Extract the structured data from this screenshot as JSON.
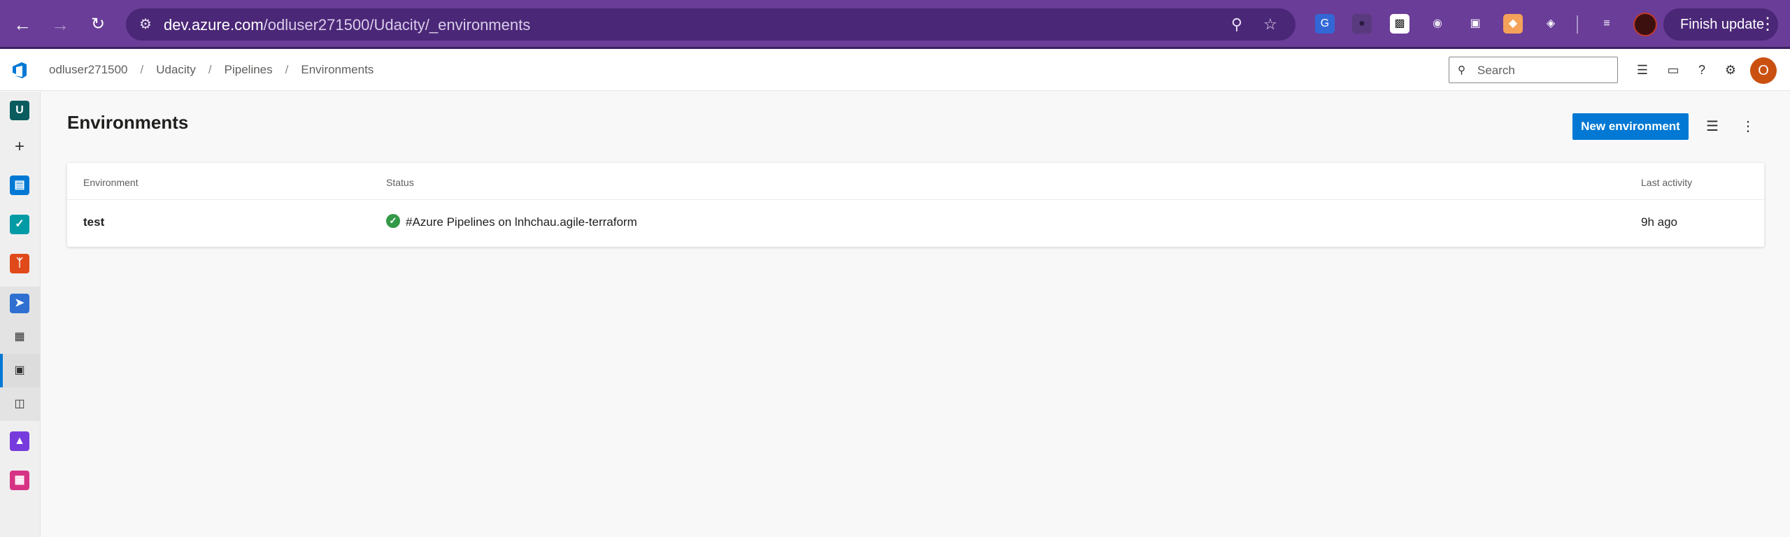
{
  "browser": {
    "url_host": "dev.azure.com",
    "url_path": "/odluser271500/Udacity/_environments",
    "finish_update_label": "Finish update",
    "icons": [
      "back-icon",
      "forward-icon",
      "reload-icon",
      "site-info-icon",
      "zoom-icon",
      "bookmark-star-icon",
      "translate-icon",
      "extension-icon",
      "qr-code-icon",
      "chrome-extension-icon",
      "picture-in-picture-icon",
      "extension-orange-icon",
      "puzzle-extensions-icon",
      "media-queue-icon",
      "profile-avatar",
      "more-vert-icon"
    ]
  },
  "header": {
    "breadcrumb": [
      "odluser271500",
      "Udacity",
      "Pipelines",
      "Environments"
    ],
    "separator": "/",
    "search_placeholder": "Search",
    "user_initial": "O",
    "icons": [
      "task-list-icon",
      "shopping-bag-icon",
      "help-icon",
      "user-settings-icon"
    ]
  },
  "left_nav": {
    "project_initial": "U",
    "items": [
      "project",
      "add",
      "overview",
      "boards",
      "repos",
      "pipelines",
      "pipelines-sub",
      "environments",
      "library",
      "test-plans",
      "artifacts"
    ]
  },
  "main": {
    "title": "Environments",
    "new_button": "New environment",
    "table": {
      "headers": {
        "environment": "Environment",
        "status": "Status",
        "last_activity": "Last activity"
      },
      "rows": [
        {
          "environment": "test",
          "status": "#Azure Pipelines on lnhchau.agile-terraform",
          "last_activity": "9h ago"
        }
      ]
    }
  },
  "colors": {
    "browser_chrome": "#6a3d98",
    "primary": "#0078d4",
    "success": "#339947",
    "avatar": "#ca5010"
  }
}
